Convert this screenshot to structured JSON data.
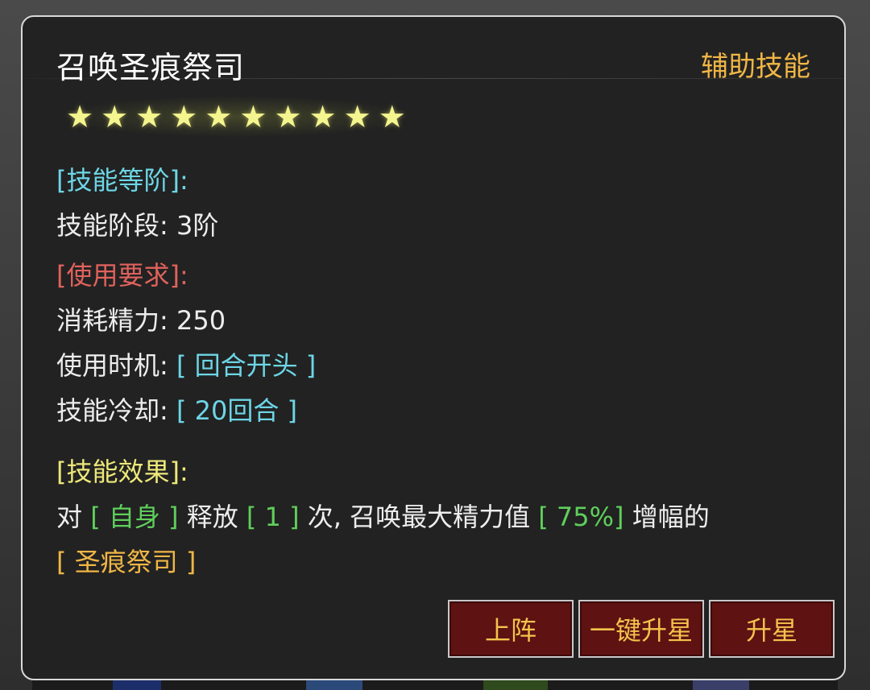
{
  "skill": {
    "name": "召唤圣痕祭司",
    "type": "辅助技能",
    "stars": [
      "★",
      "★",
      "★",
      "★",
      "★",
      "★",
      "★",
      "★",
      "★",
      "★"
    ]
  },
  "sections": {
    "level_header": "[技能等阶]:",
    "level_label": "技能阶段: ",
    "level_value": "3阶",
    "req_header": "[使用要求]:",
    "cost_label": "消耗精力: ",
    "cost_value": "250",
    "timing_label": "使用时机: ",
    "timing_value": "[ 回合开头 ]",
    "cooldown_label": "技能冷却: ",
    "cooldown_value": "[ 20回合 ]",
    "effect_header": "[技能效果]:",
    "effect": {
      "p1": "对 ",
      "target": "[ 自身 ]",
      "p2": " 释放 ",
      "count": "[ 1 ]",
      "p3": " 次, 召唤最大精力值 ",
      "percent": "[ 75%]",
      "p4": " 增幅的",
      "summon": "[ 圣痕祭司 ]"
    }
  },
  "buttons": {
    "deploy": "上阵",
    "one_click_star": "一键升星",
    "star_up": "升星"
  },
  "colors": {
    "accent_orange": "#f0b646",
    "cyan": "#6dd6e6",
    "red": "#e0625c",
    "yellow": "#ede87a",
    "green": "#5fcf5b",
    "button_bg": "#5e1212"
  }
}
